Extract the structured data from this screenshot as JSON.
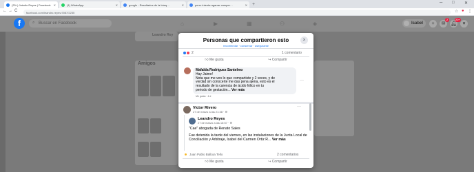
{
  "browser": {
    "tabs": [
      {
        "label": "(20+) Jaimito Reyes | Facebook",
        "favicon_color": "#1877f2",
        "active": true
      },
      {
        "label": "(1) WhatsApp",
        "favicon_color": "#25d366",
        "active": false
      },
      {
        "label": "google - Resultados de la búsq…",
        "favicon_color": "#4285f4",
        "active": false
      },
      {
        "label": "perro intenta agarrar camper…",
        "favicon_color": "#4285f4",
        "active": false
      }
    ],
    "new_tab": "+",
    "url": "facebook.com/leandro.reyes.9087/2235",
    "back": "←",
    "forward": "→",
    "reload": "C",
    "home": "⌂",
    "window_controls": [
      "─",
      "□",
      "✕"
    ]
  },
  "facebook": {
    "logo": "f",
    "search_placeholder": "Buscar en Facebook",
    "profile_name": "Isabel",
    "create": "+",
    "messenger_badge": "2",
    "notif_badge": "20+"
  },
  "background": {
    "friends_heading": "Amigos",
    "post_author_partial": "Leandro Rey"
  },
  "modal": {
    "title": "Personas que compartieron esto",
    "subtitle": "recomendar · conservar · asegurarse",
    "close": "×",
    "reaction_count": "2",
    "comments_count": "1 comentario",
    "like_label": "Me gusta",
    "share_label": "Compartir",
    "comment": {
      "author": "Mafalda Rodriguez Santelmo",
      "lines": [
        "Hay Jaime!",
        "Nota que me veo lo que compartiste y 2 veces, y de",
        "verdad sin conocerte me das pena ajena, esto es el",
        "resultado de la carencia de ácido fólico en tu",
        "periodo de gestación..."
      ],
      "more": "Ver más",
      "meta": "Me gusta · 4 d"
    },
    "sharer": {
      "name": "Victor Rivero",
      "time": "27 de marzo a las 21:38 · ⚙"
    },
    "shared_post": {
      "author": "Leandro Reyes",
      "time": "27 de marzo a las 16:57 · ⚙",
      "headline": "\"Cae\" abogada de Renato Sales",
      "body": "Fue detenida la tarde del viernes, en las instalaciones de la Junta Local de Conciliación y Arbitraje, Isabel del Carmen Ortiz R...",
      "more": "Ver más"
    },
    "shared_reactor": "Juan Pablo Balboa Tello",
    "shared_comments": "2 comentarios",
    "shared_like": "Me gusta",
    "shared_share": "Compartir"
  },
  "colors": {
    "facebook_blue": "#1877f2",
    "like_blue": "#2078f4",
    "love_red": "#f33e58",
    "notif_red": "#e41e3f"
  }
}
